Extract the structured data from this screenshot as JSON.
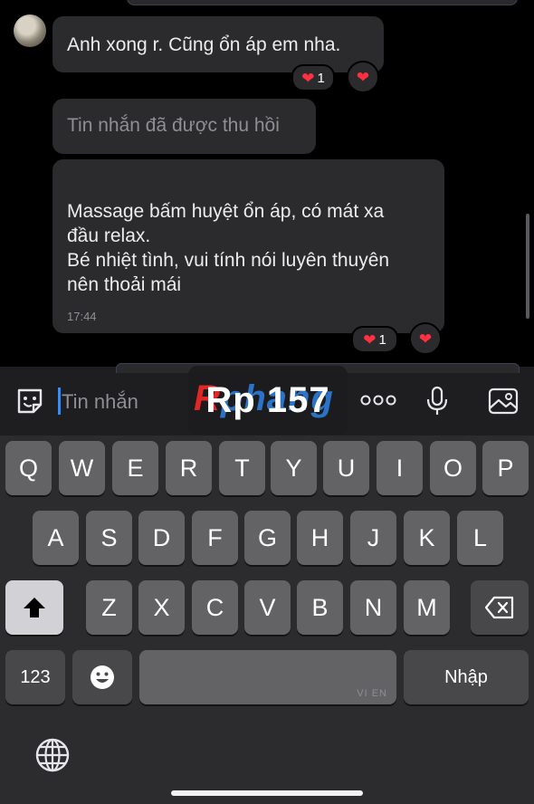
{
  "messages": [
    {
      "text": "Anh xong r. Cũng ổn áp em nha.",
      "reaction_count": "1"
    },
    {
      "text": "Tin nhắn đã được thu hồi"
    },
    {
      "lines": [
        "Massage bấm huyệt ổn áp, có mát xa",
        "đầu relax.",
        "Bé nhiệt tình, vui tính nói luyên thuyên",
        "nên thoải mái"
      ],
      "time": "17:44",
      "reaction_count": "1"
    }
  ],
  "input": {
    "placeholder": "Tin nhắn"
  },
  "watermark": {
    "text": "Rp 157",
    "background_text_pre": "R",
    "background_text": "phang"
  },
  "keyboard": {
    "row1": [
      "Q",
      "W",
      "E",
      "R",
      "T",
      "Y",
      "U",
      "I",
      "O",
      "P"
    ],
    "row2": [
      "A",
      "S",
      "D",
      "F",
      "G",
      "H",
      "J",
      "K",
      "L"
    ],
    "row3": [
      "Z",
      "X",
      "C",
      "V",
      "B",
      "N",
      "M"
    ],
    "numbers_key": "123",
    "return_key": "Nhập",
    "space_hint": "VI EN"
  },
  "colors": {
    "heart": "#ff3040",
    "caret": "#2f8fff",
    "bubble": "#2b2b2e",
    "keyboard_bg": "#2c2c2e"
  },
  "icons": [
    "sticker-icon",
    "more-icon",
    "microphone-icon",
    "image-icon",
    "heart-icon",
    "shift-icon",
    "backspace-icon",
    "emoji-icon",
    "globe-icon"
  ]
}
